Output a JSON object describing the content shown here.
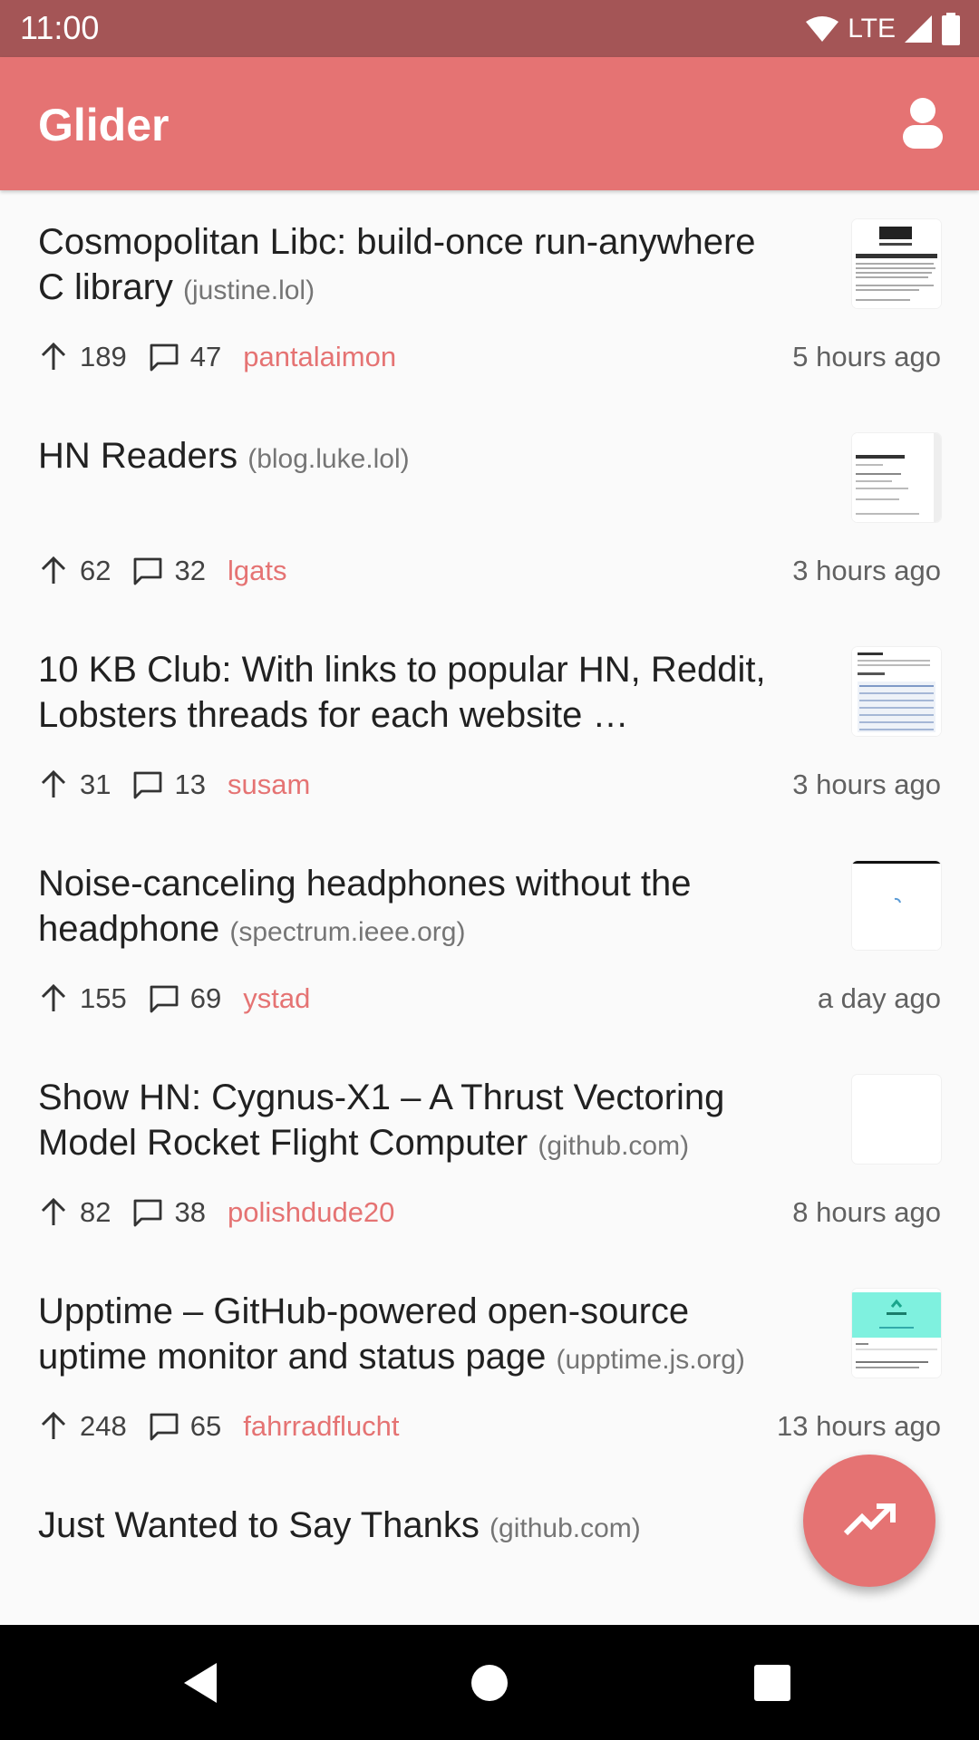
{
  "status_bar": {
    "time": "11:00",
    "network": "LTE"
  },
  "app_bar": {
    "title": "Glider",
    "account_icon": "account-icon"
  },
  "stories": [
    {
      "title": "Cosmopolitan Libc: build-once run-anywhere C library",
      "domain": "(justine.lol)",
      "score": "189",
      "comments": "47",
      "user": "pantalaimon",
      "time": "5 hours ago"
    },
    {
      "title": "HN Readers",
      "domain": "(blog.luke.lol)",
      "score": "62",
      "comments": "32",
      "user": "lgats",
      "time": "3 hours ago"
    },
    {
      "title": "10 KB Club: With links to popular HN, Reddit, Lobsters threads for each website …",
      "domain": "",
      "score": "31",
      "comments": "13",
      "user": "susam",
      "time": "3 hours ago"
    },
    {
      "title": "Noise-canceling headphones without the headphone",
      "domain": "(spectrum.ieee.org)",
      "score": "155",
      "comments": "69",
      "user": "ystad",
      "time": "a day ago"
    },
    {
      "title": "Show HN: Cygnus-X1 – A Thrust Vectoring Model Rocket Flight Computer",
      "domain": "(github.com)",
      "score": "82",
      "comments": "38",
      "user": "polishdude20",
      "time": "8 hours ago"
    },
    {
      "title": "Upptime – GitHub-powered open-source uptime monitor and status page",
      "domain": "(upptime.js.org)",
      "score": "248",
      "comments": "65",
      "user": "fahrradflucht",
      "time": "13 hours ago"
    },
    {
      "title": "Just Wanted to Say Thanks",
      "domain": "(github.com)"
    }
  ],
  "fab": {
    "icon": "trending-up-icon"
  },
  "nav_bar": {
    "back": "back-icon",
    "home": "home-icon",
    "recents": "recents-icon"
  },
  "colors": {
    "accent": "#e57373",
    "status_bar": "#a45556",
    "background": "#fafafa"
  }
}
